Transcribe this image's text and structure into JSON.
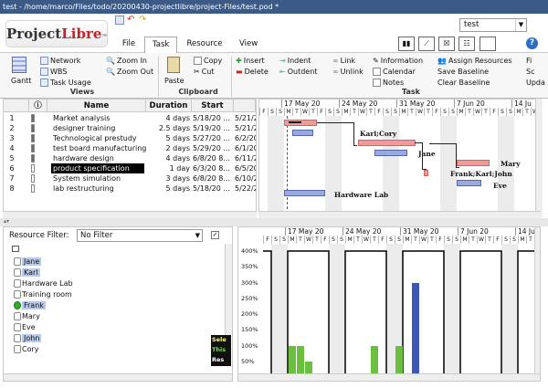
{
  "window": {
    "title": "test - /home/marco/Files/todo/20200430-projectlibre/project-Files/test.pod *"
  },
  "logo": {
    "prefix": "Project",
    "suffix": "Libre",
    "tm": "™"
  },
  "tabs": [
    {
      "label": "File"
    },
    {
      "label": "Task"
    },
    {
      "label": "Resource"
    },
    {
      "label": "View"
    }
  ],
  "project_selector": {
    "value": "test"
  },
  "ribbon": {
    "views": {
      "label": "Views",
      "gantt": "Gantt",
      "network": "Network",
      "wbs": "WBS",
      "task_usage": "Task Usage",
      "zoom_in": "Zoom In",
      "zoom_out": "Zoom Out"
    },
    "clipboard": {
      "label": "Clipboard",
      "paste": "Paste",
      "copy": "Copy",
      "cut": "Cut"
    },
    "task": {
      "label": "Task",
      "insert": "Insert",
      "delete": "Delete",
      "indent": "Indent",
      "outdent": "Outdent",
      "link": "Link",
      "unlink": "Unlink",
      "information": "Information",
      "calendar": "Calendar",
      "notes": "Notes",
      "assign_resources": "Assign Resources",
      "save_baseline": "Save Baseline",
      "clear_baseline": "Clear Baseline",
      "more1": "Fi",
      "more2": "Sc",
      "more3": "Upda"
    }
  },
  "table": {
    "headers": {
      "name": "Name",
      "duration": "Duration",
      "start": "Start"
    },
    "rows": [
      {
        "id": "1",
        "name": "Market analysis",
        "duration": "4 days",
        "start": "5/18/20 ...",
        "extra": "5/21/2"
      },
      {
        "id": "2",
        "name": "designer training",
        "duration": "2.5 days",
        "start": "5/19/20 ...",
        "extra": "5/21/2"
      },
      {
        "id": "3",
        "name": "Technological prestudy",
        "duration": "5 days",
        "start": "5/27/20 ...",
        "extra": "6/2/20"
      },
      {
        "id": "4",
        "name": "test board manufacturing",
        "duration": "2 days",
        "start": "5/29/20 ...",
        "extra": "6/1/20"
      },
      {
        "id": "5",
        "name": "hardware design",
        "duration": "4 days",
        "start": "6/8/20 8...",
        "extra": "6/11/2"
      },
      {
        "id": "6",
        "name": "product specification",
        "duration": "1 day",
        "start": "6/3/20 8...",
        "extra": "6/5/20"
      },
      {
        "id": "7",
        "name": "System simulation",
        "duration": "3 days",
        "start": "6/8/20 8...",
        "extra": "6/10/2"
      },
      {
        "id": "8",
        "name": "lab restructuring",
        "duration": "5 days",
        "start": "5/18/20 ...",
        "extra": "5/22/2"
      }
    ]
  },
  "gantt": {
    "weeks": [
      "17 May 20",
      "24 May 20",
      "31 May 20",
      "7 Jun 20",
      "14 Ju"
    ],
    "days": [
      "F",
      "S",
      "S",
      "M",
      "T",
      "W",
      "T",
      "F",
      "S",
      "S",
      "M",
      "T",
      "W",
      "T",
      "F",
      "S",
      "S",
      "M",
      "T",
      "W",
      "T",
      "F",
      "S",
      "S",
      "M",
      "T",
      "W",
      "T",
      "F",
      "S",
      "S",
      "M",
      "T",
      "W",
      "T"
    ],
    "labels": {
      "karl_cory": "Karl;Cory",
      "jane": "Jane",
      "mary": "Mary",
      "frank_karl_john": "Frank;Karl;John",
      "eve": "Eve",
      "hardware_lab": "Hardware Lab"
    }
  },
  "resources": {
    "filter_label": "Resource Filter:",
    "filter_value": "No Filter",
    "items": [
      {
        "name": "Jane"
      },
      {
        "name": "Karl"
      },
      {
        "name": "Hardware Lab"
      },
      {
        "name": "Training room"
      },
      {
        "name": "Frank"
      },
      {
        "name": "Mary"
      },
      {
        "name": "Eve"
      },
      {
        "name": "John"
      },
      {
        "name": "Cory"
      }
    ],
    "legend": [
      "Sele",
      "This",
      "Res"
    ]
  },
  "histogram": {
    "y_ticks": [
      "400%",
      "350%",
      "300%",
      "250%",
      "200%",
      "150%",
      "100%",
      "50%",
      "0%"
    ],
    "bars": [
      {
        "day": 3,
        "value": 100,
        "color": "#6bbf3f"
      },
      {
        "day": 4,
        "value": 100,
        "color": "#6bbf3f"
      },
      {
        "day": 5,
        "value": 50,
        "color": "#6bbf3f"
      },
      {
        "day": 13,
        "value": 100,
        "color": "#6bbf3f"
      },
      {
        "day": 16,
        "value": 100,
        "color": "#6bbf3f"
      },
      {
        "day": 18,
        "value": 300,
        "color": "#3e57b4"
      }
    ]
  },
  "colors": {
    "titlebar": "#3c5a86",
    "task_bar": "#f29a9a",
    "resource_bar": "#9aaade",
    "hist_green": "#6bbf3f",
    "hist_blue": "#3e57b4"
  }
}
